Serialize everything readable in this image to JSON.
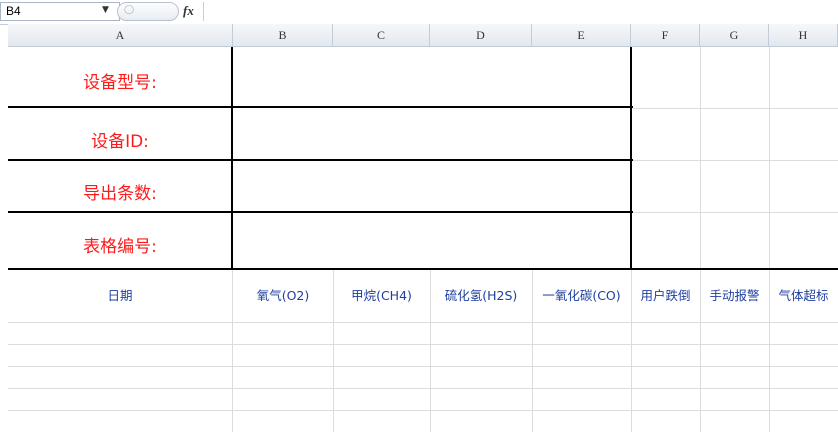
{
  "formula_bar": {
    "name_box": "B4",
    "fx": "fx",
    "content": ""
  },
  "columns": [
    "A",
    "B",
    "C",
    "D",
    "E",
    "F",
    "G",
    "H"
  ],
  "info_labels": [
    "设备型号:",
    "设备ID:",
    "导出条数:",
    "表格编号:"
  ],
  "headers": [
    "日期",
    "氧气(O2)",
    "甲烷(CH4)",
    "硫化氢(H2S)",
    "一氧化碳(CO)",
    "用户跌倒",
    "手动报警",
    "气体超标"
  ],
  "colors": {
    "label_text": "#ff1a1a",
    "header_text": "#1f3f9f",
    "grid": "#dadcdd",
    "border": "#000000"
  }
}
